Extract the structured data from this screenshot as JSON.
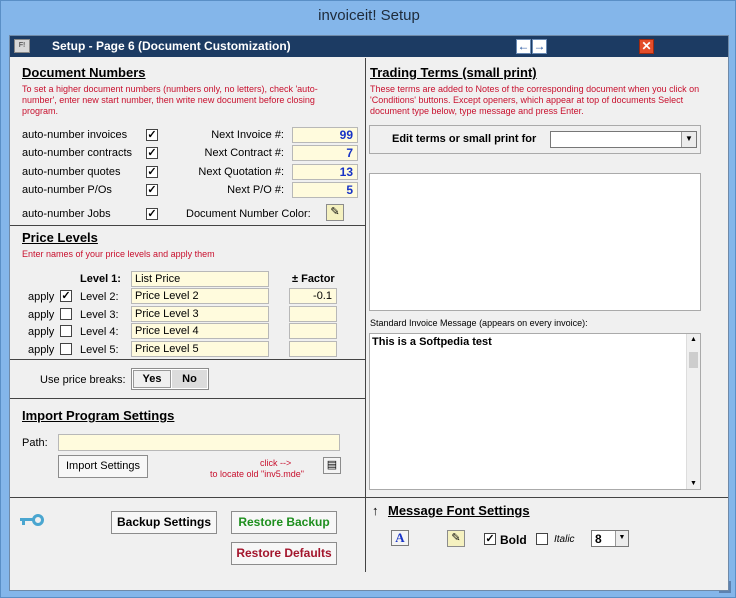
{
  "window": {
    "title": "invoiceit! Setup"
  },
  "titlebar": {
    "sys_label": "F!",
    "title": "Setup - Page 6 (Document Customization)",
    "prev_icon": "arrow-left",
    "next_icon": "arrow-right",
    "close_icon": "close"
  },
  "doc_numbers": {
    "heading": "Document Numbers",
    "help": "To set a higher document numbers (numbers only, no letters), check 'auto-number', enter new start number, then write new document before closing program.",
    "rows": [
      {
        "label": "auto-number invoices",
        "checked": "✓",
        "next_label": "Next Invoice #:",
        "value": "99"
      },
      {
        "label": "auto-number contracts",
        "checked": "✓",
        "next_label": "Next Contract #:",
        "value": "7"
      },
      {
        "label": "auto-number quotes",
        "checked": "✓",
        "next_label": "Next Quotation #:",
        "value": "13"
      },
      {
        "label": "auto-number P/Os",
        "checked": "✓",
        "next_label": "Next P/O #:",
        "value": "5"
      }
    ],
    "jobs_label": "auto-number Jobs",
    "jobs_checked": "✓",
    "color_label": "Document Number Color:"
  },
  "price_levels": {
    "heading": "Price Levels",
    "help": "Enter names of your price levels and apply them",
    "factor_header": "± Factor",
    "level1_label": "Level 1:",
    "level1_value": "List Price",
    "rows": [
      {
        "apply": "apply",
        "checked": "✓",
        "label": "Level 2:",
        "value": "Price Level 2",
        "factor": "-0.1"
      },
      {
        "apply": "apply",
        "checked": "",
        "label": "Level 3:",
        "value": "Price Level 3",
        "factor": ""
      },
      {
        "apply": "apply",
        "checked": "",
        "label": "Level 4:",
        "value": "Price Level 4",
        "factor": ""
      },
      {
        "apply": "apply",
        "checked": "",
        "label": "Level 5:",
        "value": "Price Level 5",
        "factor": ""
      }
    ],
    "breaks_label": "Use price breaks:",
    "yes": "Yes",
    "no": "No"
  },
  "import": {
    "heading": "Import Program Settings",
    "path_label": "Path:",
    "path_value": "",
    "button": "Import Settings",
    "hint1": "click -->",
    "hint2": "to locate old \"inv5.mde\""
  },
  "bottom_buttons": {
    "backup": "Backup Settings",
    "restore": "Restore Backup",
    "defaults": "Restore Defaults"
  },
  "trading": {
    "heading": "Trading Terms (small print)",
    "help": "These terms are added to Notes of the corresponding document when you click on 'Conditions' buttons. Except openers, which appear at top of documents Select document type below, type message and press Enter.",
    "edit_label": "Edit terms or small print for",
    "select_value": ""
  },
  "invoice_msg": {
    "label": "Standard Invoice Message (appears on every invoice):",
    "value": "This is a Softpedia test"
  },
  "font": {
    "heading": "Message Font Settings",
    "bold_checked": "✓",
    "bold_label": "Bold",
    "italic_checked": "",
    "italic_label": "Italic",
    "size": "8"
  },
  "colors": {
    "accent_blue": "#1733c6",
    "help_red": "#c8102e",
    "restore_green": "#1e8f1e",
    "restore_red": "#a3152c",
    "title_bar": "#1c3b63"
  }
}
